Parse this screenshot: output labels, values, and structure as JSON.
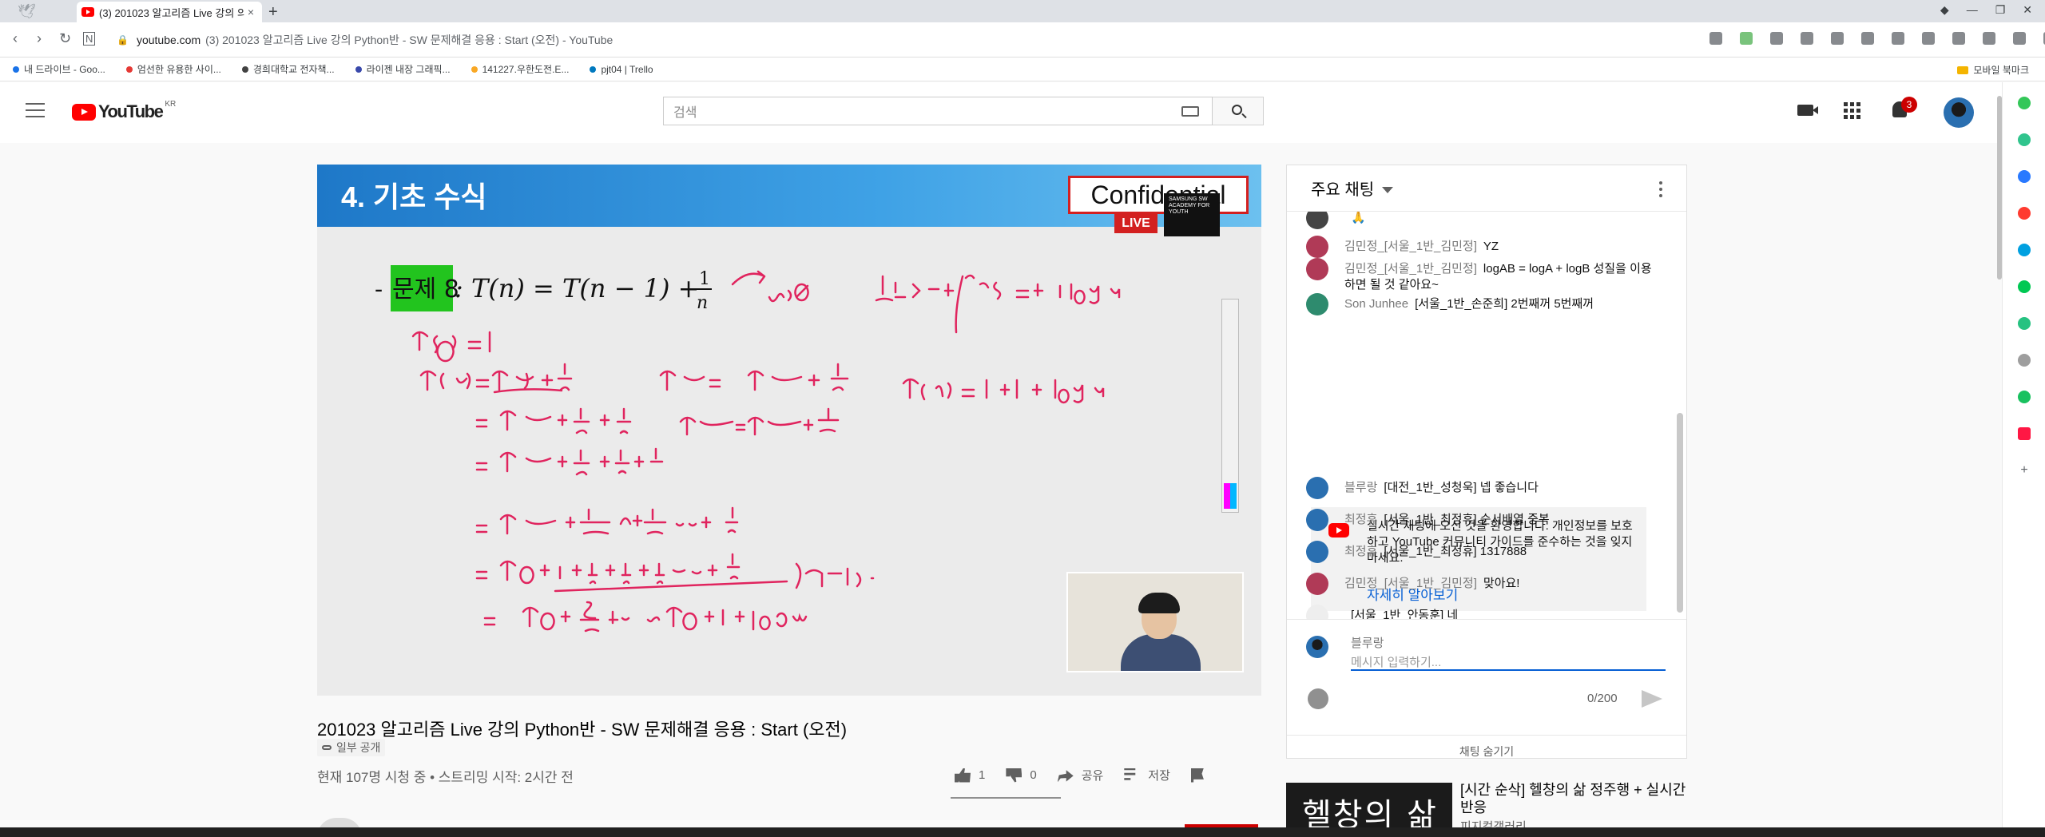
{
  "browser": {
    "tab_title": "(3) 201023 알고리즘 Live 강의 의",
    "new_tab": "+",
    "close_tab": "×",
    "url_host": "youtube.com",
    "url_rest": "(3) 201023 알고리즘 Live 강의 Python반 - SW 문제해결 응용 : Start (오전) - YouTube",
    "bookmarks": [
      {
        "label": "내 드라이브 - Goo...",
        "color": "#1a73e8"
      },
      {
        "label": "엄선한 유용한 사이...",
        "color": "#e53935"
      },
      {
        "label": "경희대학교 전자책...",
        "color": "#424242"
      },
      {
        "label": "라이젠 내장 그래픽...",
        "color": "#3949ab"
      },
      {
        "label": "141227.우한도전.E...",
        "color": "#f9a825"
      },
      {
        "label": "pjt04 | Trello",
        "color": "#0079bf"
      }
    ],
    "mobile_bookmarks": "모바일 북마크"
  },
  "header": {
    "logo_text": "YouTube",
    "region": "KR",
    "search_placeholder": "검색",
    "notification_count": "3"
  },
  "video": {
    "slide_title": "4. 기초 수식",
    "confidential": "Confidential",
    "live": "LIVE",
    "samsung_tag": "SAMSUNG SW ACADEMY FOR YOUTH",
    "problem_label": "문제 8",
    "title": "201023 알고리즘 Live 강의 Python반 - SW 문제해결 응용 : Start (오전)",
    "privacy": "일부 공개",
    "stats": "현재 107명 시청 중 • 스트리밍 시작: 2시간 전",
    "likes": "1",
    "dislikes": "0",
    "share": "공유",
    "save": "저장"
  },
  "chat": {
    "header": "주요 채팅",
    "messages": [
      {
        "author": "",
        "text": "🙏",
        "avatar_color": "#444444"
      },
      {
        "author": "김민정_[서울_1반_김민정]",
        "text": "YZ",
        "avatar_color": "#b03a57"
      },
      {
        "author": "김민정_[서울_1반_김민정]",
        "text": "logAB = logA + logB 성질을 이용하면 될 것 같아요~",
        "avatar_color": "#b03a57"
      },
      {
        "author": "Son Junhee",
        "text": "[서울_1반_손준희] 2번째꺼 5번째꺼",
        "avatar_color": "#2e8b6e"
      },
      {
        "author": "블루랑",
        "text": "[대전_1반_성청욱] 넵 좋습니다",
        "avatar_color": "#2a6fb0"
      },
      {
        "author": "최정휴",
        "text": "[서울_1반_최정휴] 순서배열 중복",
        "avatar_color": "#2a6fb0"
      },
      {
        "author": "최정휴",
        "text": "[서울_1반_최정휴] 1317888",
        "avatar_color": "#2a6fb0"
      },
      {
        "author": "김민정_[서울_1반_김민정]",
        "text": "맞아요!",
        "avatar_color": "#b03a57"
      },
      {
        "author": "",
        "text": "[서울_1반_안동훈]  네",
        "avatar_color": "#eeeeee"
      }
    ],
    "notice_text": "실시간 채팅에 오신 것을 환영합니다. 개인정보를 보호하고 YouTube 커뮤니티 가이드를 준수하는 것을 잊지 마세요.",
    "notice_link": "자세히 알아보기",
    "input_user": "블루랑",
    "input_placeholder": "메시지 입력하기...",
    "char_count": "0/200",
    "hide_chat": "채팅 숨기기"
  },
  "recommendation": {
    "thumb_text": "헬창의 삶",
    "title": "[시간 순삭] 헬창의 삶 정주행 + 실시간 반응",
    "channel": "피지컬갤러리"
  },
  "colors": {
    "youtube_red": "#ff0000",
    "link_blue": "#065fd4",
    "ink_pink": "#e0245e",
    "green_highlight": "#22c41e"
  }
}
